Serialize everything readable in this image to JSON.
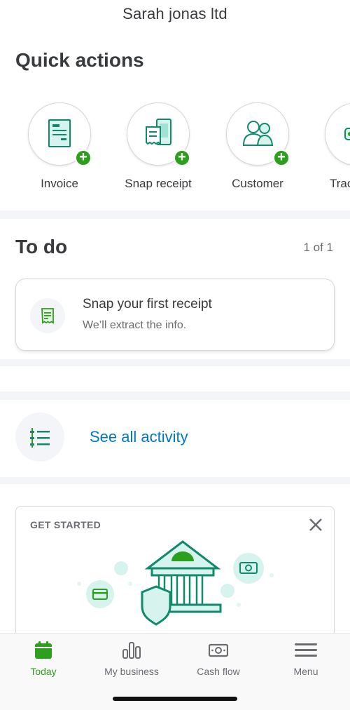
{
  "header": {
    "company_name": "Sarah jonas ltd"
  },
  "quick_actions": {
    "title": "Quick actions",
    "items": [
      {
        "label": "Invoice",
        "icon": "invoice-icon"
      },
      {
        "label": "Snap receipt",
        "icon": "snap-receipt-icon"
      },
      {
        "label": "Customer",
        "icon": "customer-icon"
      },
      {
        "label": "Track mileage",
        "icon": "car-icon"
      }
    ]
  },
  "todo": {
    "title": "To do",
    "count": "1 of 1",
    "card": {
      "heading": "Snap your first receipt",
      "subtext": "We’ll extract the info.",
      "icon": "receipt-icon"
    }
  },
  "activity": {
    "link_label": "See all activity",
    "icon": "activity-list-icon"
  },
  "get_started": {
    "label": "GET STARTED",
    "close_icon": "close-icon",
    "illustration": "bank-illustration"
  },
  "tabbar": {
    "tabs": [
      {
        "label": "Today",
        "icon": "calendar-icon",
        "active": true
      },
      {
        "label": "My business",
        "icon": "bar-chart-icon",
        "active": false
      },
      {
        "label": "Cash flow",
        "icon": "cash-icon",
        "active": false
      },
      {
        "label": "Menu",
        "icon": "hamburger-icon",
        "active": false
      }
    ]
  },
  "colors": {
    "brand_green": "#2ca01c",
    "link_blue": "#0077c5",
    "icon_teal": "#108000",
    "text_dark": "#393a3d",
    "text_muted": "#6b6c72"
  }
}
